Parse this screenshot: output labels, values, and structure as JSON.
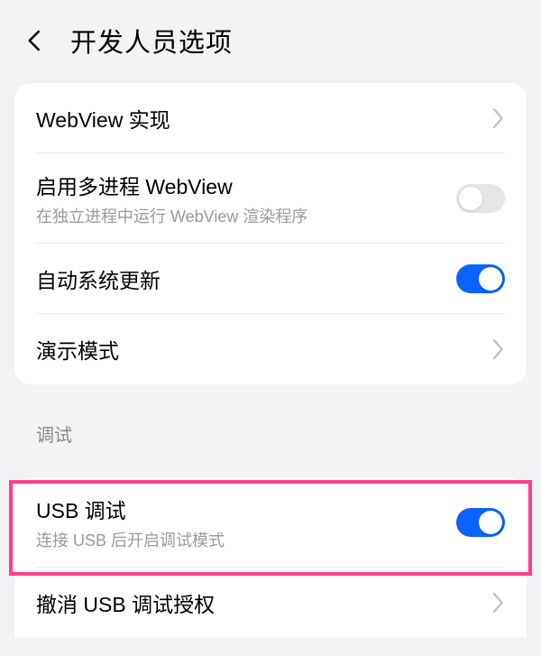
{
  "header": {
    "title": "开发人员选项"
  },
  "group1": {
    "webview_impl": {
      "title": "WebView 实现"
    },
    "multiprocess_webview": {
      "title": "启用多进程 WebView",
      "subtitle": "在独立进程中运行 WebView 渲染程序",
      "enabled": false
    },
    "auto_system_update": {
      "title": "自动系统更新",
      "enabled": true
    },
    "demo_mode": {
      "title": "演示模式"
    }
  },
  "section_debug": {
    "label": "调试"
  },
  "group2": {
    "usb_debug": {
      "title": "USB 调试",
      "subtitle": "连接 USB 后开启调试模式",
      "enabled": true
    },
    "revoke_usb": {
      "title": "撤消 USB 调试授权"
    }
  },
  "colors": {
    "accent": "#0a63ff",
    "highlight": "#ff3d8b"
  }
}
